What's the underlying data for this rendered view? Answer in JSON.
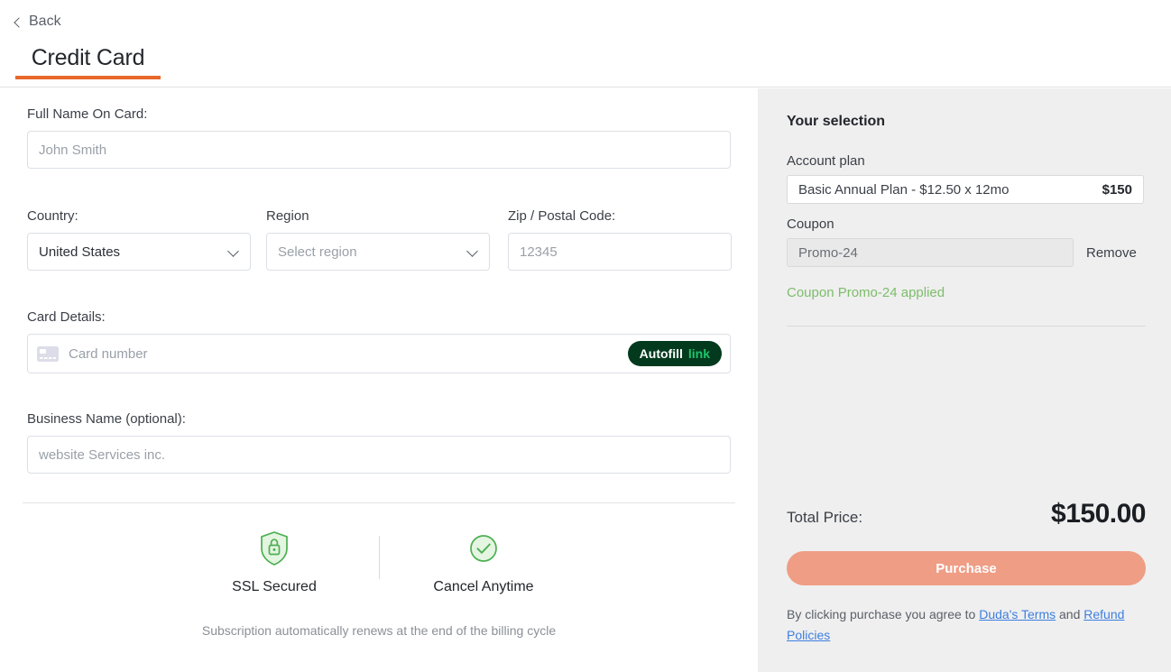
{
  "window": {
    "close_icon": "close-icon"
  },
  "header": {
    "back_label": "Back",
    "back_icon": "chevron-left-icon",
    "tab_label": "Credit Card",
    "accent_color": "#e8682c"
  },
  "form": {
    "full_name": {
      "label": "Full Name On Card:",
      "value": "",
      "placeholder": "John Smith"
    },
    "country": {
      "label": "Country:",
      "value": "United States",
      "chevron_icon": "chevron-down-icon"
    },
    "region": {
      "label": "Region",
      "value": "",
      "placeholder": "Select region",
      "chevron_icon": "chevron-down-icon"
    },
    "zip": {
      "label": "Zip / Postal Code:",
      "value": "",
      "placeholder": "12345"
    },
    "card_details": {
      "label": "Card Details:",
      "placeholder": "Card number",
      "card_icon": "credit-card-icon",
      "autofill_text": "Autofill",
      "autofill_brand": "link",
      "badge_bg": "#033a1e",
      "badge_brand_color": "#1ec46a"
    },
    "business_name": {
      "label": "Business Name (optional):",
      "value": "",
      "placeholder": "website Services inc."
    },
    "badges": [
      {
        "icon": "shield-lock-icon",
        "label": "SSL Secured",
        "color": "#4caf50"
      },
      {
        "icon": "check-circle-icon",
        "label": "Cancel Anytime",
        "color": "#4caf50"
      }
    ],
    "renew_note": "Subscription automatically renews at the end of the billing cycle"
  },
  "sidebar": {
    "title": "Your selection",
    "account_plan_label": "Account plan",
    "plan_name": "Basic Annual Plan - $12.50 x 12mo",
    "plan_price": "$150",
    "coupon_label": "Coupon",
    "coupon_value": "Promo-24",
    "coupon_remove_label": "Remove",
    "coupon_applied_message": "Coupon Promo-24 applied",
    "coupon_applied_color": "#7dbd6b",
    "total_label": "Total Price:",
    "total_value": "$150.00",
    "purchase_label": "Purchase",
    "purchase_color": "#ef9d85",
    "agree_prefix": "By clicking purchase you agree to ",
    "terms_link": "Duda's Terms",
    "agree_middle": " and",
    "refund_link": "Refund Policies"
  }
}
